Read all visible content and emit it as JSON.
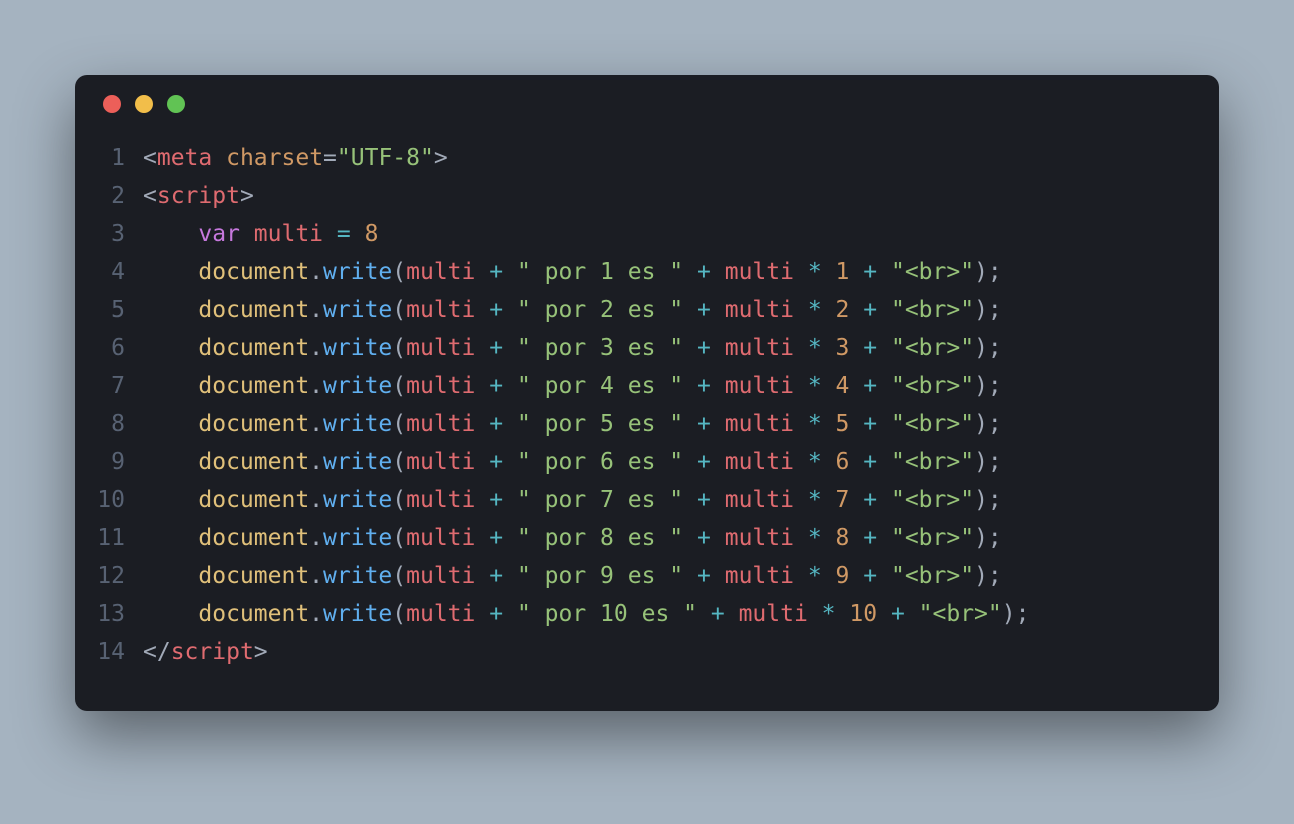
{
  "window": {
    "dots": [
      "red",
      "yellow",
      "green"
    ]
  },
  "lines": [
    {
      "num": "1",
      "tokens": [
        {
          "c": "punct",
          "t": "<"
        },
        {
          "c": "tag-red",
          "t": "meta"
        },
        {
          "c": "default",
          "t": " "
        },
        {
          "c": "attr",
          "t": "charset"
        },
        {
          "c": "punct",
          "t": "="
        },
        {
          "c": "string",
          "t": "\"UTF-8\""
        },
        {
          "c": "punct",
          "t": ">"
        }
      ]
    },
    {
      "num": "2",
      "tokens": [
        {
          "c": "punct",
          "t": "<"
        },
        {
          "c": "tag-red",
          "t": "script"
        },
        {
          "c": "punct",
          "t": ">"
        }
      ]
    },
    {
      "num": "3",
      "tokens": [
        {
          "c": "default",
          "t": "    "
        },
        {
          "c": "keyword",
          "t": "var"
        },
        {
          "c": "default",
          "t": " "
        },
        {
          "c": "varname",
          "t": "multi"
        },
        {
          "c": "default",
          "t": " "
        },
        {
          "c": "op",
          "t": "="
        },
        {
          "c": "default",
          "t": " "
        },
        {
          "c": "num",
          "t": "8"
        }
      ]
    },
    {
      "num": "4",
      "tokens": [
        {
          "c": "default",
          "t": "    "
        },
        {
          "c": "ident",
          "t": "document"
        },
        {
          "c": "punct",
          "t": "."
        },
        {
          "c": "method",
          "t": "write"
        },
        {
          "c": "punct",
          "t": "("
        },
        {
          "c": "varname",
          "t": "multi"
        },
        {
          "c": "default",
          "t": " "
        },
        {
          "c": "op",
          "t": "+"
        },
        {
          "c": "default",
          "t": " "
        },
        {
          "c": "string",
          "t": "\" por 1 es \""
        },
        {
          "c": "default",
          "t": " "
        },
        {
          "c": "op",
          "t": "+"
        },
        {
          "c": "default",
          "t": " "
        },
        {
          "c": "varname",
          "t": "multi"
        },
        {
          "c": "default",
          "t": " "
        },
        {
          "c": "op",
          "t": "*"
        },
        {
          "c": "default",
          "t": " "
        },
        {
          "c": "num",
          "t": "1"
        },
        {
          "c": "default",
          "t": " "
        },
        {
          "c": "op",
          "t": "+"
        },
        {
          "c": "default",
          "t": " "
        },
        {
          "c": "string",
          "t": "\"<br>\""
        },
        {
          "c": "punct",
          "t": ");"
        }
      ]
    },
    {
      "num": "5",
      "tokens": [
        {
          "c": "default",
          "t": "    "
        },
        {
          "c": "ident",
          "t": "document"
        },
        {
          "c": "punct",
          "t": "."
        },
        {
          "c": "method",
          "t": "write"
        },
        {
          "c": "punct",
          "t": "("
        },
        {
          "c": "varname",
          "t": "multi"
        },
        {
          "c": "default",
          "t": " "
        },
        {
          "c": "op",
          "t": "+"
        },
        {
          "c": "default",
          "t": " "
        },
        {
          "c": "string",
          "t": "\" por 2 es \""
        },
        {
          "c": "default",
          "t": " "
        },
        {
          "c": "op",
          "t": "+"
        },
        {
          "c": "default",
          "t": " "
        },
        {
          "c": "varname",
          "t": "multi"
        },
        {
          "c": "default",
          "t": " "
        },
        {
          "c": "op",
          "t": "*"
        },
        {
          "c": "default",
          "t": " "
        },
        {
          "c": "num",
          "t": "2"
        },
        {
          "c": "default",
          "t": " "
        },
        {
          "c": "op",
          "t": "+"
        },
        {
          "c": "default",
          "t": " "
        },
        {
          "c": "string",
          "t": "\"<br>\""
        },
        {
          "c": "punct",
          "t": ");"
        }
      ]
    },
    {
      "num": "6",
      "tokens": [
        {
          "c": "default",
          "t": "    "
        },
        {
          "c": "ident",
          "t": "document"
        },
        {
          "c": "punct",
          "t": "."
        },
        {
          "c": "method",
          "t": "write"
        },
        {
          "c": "punct",
          "t": "("
        },
        {
          "c": "varname",
          "t": "multi"
        },
        {
          "c": "default",
          "t": " "
        },
        {
          "c": "op",
          "t": "+"
        },
        {
          "c": "default",
          "t": " "
        },
        {
          "c": "string",
          "t": "\" por 3 es \""
        },
        {
          "c": "default",
          "t": " "
        },
        {
          "c": "op",
          "t": "+"
        },
        {
          "c": "default",
          "t": " "
        },
        {
          "c": "varname",
          "t": "multi"
        },
        {
          "c": "default",
          "t": " "
        },
        {
          "c": "op",
          "t": "*"
        },
        {
          "c": "default",
          "t": " "
        },
        {
          "c": "num",
          "t": "3"
        },
        {
          "c": "default",
          "t": " "
        },
        {
          "c": "op",
          "t": "+"
        },
        {
          "c": "default",
          "t": " "
        },
        {
          "c": "string",
          "t": "\"<br>\""
        },
        {
          "c": "punct",
          "t": ");"
        }
      ]
    },
    {
      "num": "7",
      "tokens": [
        {
          "c": "default",
          "t": "    "
        },
        {
          "c": "ident",
          "t": "document"
        },
        {
          "c": "punct",
          "t": "."
        },
        {
          "c": "method",
          "t": "write"
        },
        {
          "c": "punct",
          "t": "("
        },
        {
          "c": "varname",
          "t": "multi"
        },
        {
          "c": "default",
          "t": " "
        },
        {
          "c": "op",
          "t": "+"
        },
        {
          "c": "default",
          "t": " "
        },
        {
          "c": "string",
          "t": "\" por 4 es \""
        },
        {
          "c": "default",
          "t": " "
        },
        {
          "c": "op",
          "t": "+"
        },
        {
          "c": "default",
          "t": " "
        },
        {
          "c": "varname",
          "t": "multi"
        },
        {
          "c": "default",
          "t": " "
        },
        {
          "c": "op",
          "t": "*"
        },
        {
          "c": "default",
          "t": " "
        },
        {
          "c": "num",
          "t": "4"
        },
        {
          "c": "default",
          "t": " "
        },
        {
          "c": "op",
          "t": "+"
        },
        {
          "c": "default",
          "t": " "
        },
        {
          "c": "string",
          "t": "\"<br>\""
        },
        {
          "c": "punct",
          "t": ");"
        }
      ]
    },
    {
      "num": "8",
      "tokens": [
        {
          "c": "default",
          "t": "    "
        },
        {
          "c": "ident",
          "t": "document"
        },
        {
          "c": "punct",
          "t": "."
        },
        {
          "c": "method",
          "t": "write"
        },
        {
          "c": "punct",
          "t": "("
        },
        {
          "c": "varname",
          "t": "multi"
        },
        {
          "c": "default",
          "t": " "
        },
        {
          "c": "op",
          "t": "+"
        },
        {
          "c": "default",
          "t": " "
        },
        {
          "c": "string",
          "t": "\" por 5 es \""
        },
        {
          "c": "default",
          "t": " "
        },
        {
          "c": "op",
          "t": "+"
        },
        {
          "c": "default",
          "t": " "
        },
        {
          "c": "varname",
          "t": "multi"
        },
        {
          "c": "default",
          "t": " "
        },
        {
          "c": "op",
          "t": "*"
        },
        {
          "c": "default",
          "t": " "
        },
        {
          "c": "num",
          "t": "5"
        },
        {
          "c": "default",
          "t": " "
        },
        {
          "c": "op",
          "t": "+"
        },
        {
          "c": "default",
          "t": " "
        },
        {
          "c": "string",
          "t": "\"<br>\""
        },
        {
          "c": "punct",
          "t": ");"
        }
      ]
    },
    {
      "num": "9",
      "tokens": [
        {
          "c": "default",
          "t": "    "
        },
        {
          "c": "ident",
          "t": "document"
        },
        {
          "c": "punct",
          "t": "."
        },
        {
          "c": "method",
          "t": "write"
        },
        {
          "c": "punct",
          "t": "("
        },
        {
          "c": "varname",
          "t": "multi"
        },
        {
          "c": "default",
          "t": " "
        },
        {
          "c": "op",
          "t": "+"
        },
        {
          "c": "default",
          "t": " "
        },
        {
          "c": "string",
          "t": "\" por 6 es \""
        },
        {
          "c": "default",
          "t": " "
        },
        {
          "c": "op",
          "t": "+"
        },
        {
          "c": "default",
          "t": " "
        },
        {
          "c": "varname",
          "t": "multi"
        },
        {
          "c": "default",
          "t": " "
        },
        {
          "c": "op",
          "t": "*"
        },
        {
          "c": "default",
          "t": " "
        },
        {
          "c": "num",
          "t": "6"
        },
        {
          "c": "default",
          "t": " "
        },
        {
          "c": "op",
          "t": "+"
        },
        {
          "c": "default",
          "t": " "
        },
        {
          "c": "string",
          "t": "\"<br>\""
        },
        {
          "c": "punct",
          "t": ");"
        }
      ]
    },
    {
      "num": "10",
      "tokens": [
        {
          "c": "default",
          "t": "    "
        },
        {
          "c": "ident",
          "t": "document"
        },
        {
          "c": "punct",
          "t": "."
        },
        {
          "c": "method",
          "t": "write"
        },
        {
          "c": "punct",
          "t": "("
        },
        {
          "c": "varname",
          "t": "multi"
        },
        {
          "c": "default",
          "t": " "
        },
        {
          "c": "op",
          "t": "+"
        },
        {
          "c": "default",
          "t": " "
        },
        {
          "c": "string",
          "t": "\" por 7 es \""
        },
        {
          "c": "default",
          "t": " "
        },
        {
          "c": "op",
          "t": "+"
        },
        {
          "c": "default",
          "t": " "
        },
        {
          "c": "varname",
          "t": "multi"
        },
        {
          "c": "default",
          "t": " "
        },
        {
          "c": "op",
          "t": "*"
        },
        {
          "c": "default",
          "t": " "
        },
        {
          "c": "num",
          "t": "7"
        },
        {
          "c": "default",
          "t": " "
        },
        {
          "c": "op",
          "t": "+"
        },
        {
          "c": "default",
          "t": " "
        },
        {
          "c": "string",
          "t": "\"<br>\""
        },
        {
          "c": "punct",
          "t": ");"
        }
      ]
    },
    {
      "num": "11",
      "tokens": [
        {
          "c": "default",
          "t": "    "
        },
        {
          "c": "ident",
          "t": "document"
        },
        {
          "c": "punct",
          "t": "."
        },
        {
          "c": "method",
          "t": "write"
        },
        {
          "c": "punct",
          "t": "("
        },
        {
          "c": "varname",
          "t": "multi"
        },
        {
          "c": "default",
          "t": " "
        },
        {
          "c": "op",
          "t": "+"
        },
        {
          "c": "default",
          "t": " "
        },
        {
          "c": "string",
          "t": "\" por 8 es \""
        },
        {
          "c": "default",
          "t": " "
        },
        {
          "c": "op",
          "t": "+"
        },
        {
          "c": "default",
          "t": " "
        },
        {
          "c": "varname",
          "t": "multi"
        },
        {
          "c": "default",
          "t": " "
        },
        {
          "c": "op",
          "t": "*"
        },
        {
          "c": "default",
          "t": " "
        },
        {
          "c": "num",
          "t": "8"
        },
        {
          "c": "default",
          "t": " "
        },
        {
          "c": "op",
          "t": "+"
        },
        {
          "c": "default",
          "t": " "
        },
        {
          "c": "string",
          "t": "\"<br>\""
        },
        {
          "c": "punct",
          "t": ");"
        }
      ]
    },
    {
      "num": "12",
      "tokens": [
        {
          "c": "default",
          "t": "    "
        },
        {
          "c": "ident",
          "t": "document"
        },
        {
          "c": "punct",
          "t": "."
        },
        {
          "c": "method",
          "t": "write"
        },
        {
          "c": "punct",
          "t": "("
        },
        {
          "c": "varname",
          "t": "multi"
        },
        {
          "c": "default",
          "t": " "
        },
        {
          "c": "op",
          "t": "+"
        },
        {
          "c": "default",
          "t": " "
        },
        {
          "c": "string",
          "t": "\" por 9 es \""
        },
        {
          "c": "default",
          "t": " "
        },
        {
          "c": "op",
          "t": "+"
        },
        {
          "c": "default",
          "t": " "
        },
        {
          "c": "varname",
          "t": "multi"
        },
        {
          "c": "default",
          "t": " "
        },
        {
          "c": "op",
          "t": "*"
        },
        {
          "c": "default",
          "t": " "
        },
        {
          "c": "num",
          "t": "9"
        },
        {
          "c": "default",
          "t": " "
        },
        {
          "c": "op",
          "t": "+"
        },
        {
          "c": "default",
          "t": " "
        },
        {
          "c": "string",
          "t": "\"<br>\""
        },
        {
          "c": "punct",
          "t": ");"
        }
      ]
    },
    {
      "num": "13",
      "tokens": [
        {
          "c": "default",
          "t": "    "
        },
        {
          "c": "ident",
          "t": "document"
        },
        {
          "c": "punct",
          "t": "."
        },
        {
          "c": "method",
          "t": "write"
        },
        {
          "c": "punct",
          "t": "("
        },
        {
          "c": "varname",
          "t": "multi"
        },
        {
          "c": "default",
          "t": " "
        },
        {
          "c": "op",
          "t": "+"
        },
        {
          "c": "default",
          "t": " "
        },
        {
          "c": "string",
          "t": "\" por 10 es \""
        },
        {
          "c": "default",
          "t": " "
        },
        {
          "c": "op",
          "t": "+"
        },
        {
          "c": "default",
          "t": " "
        },
        {
          "c": "varname",
          "t": "multi"
        },
        {
          "c": "default",
          "t": " "
        },
        {
          "c": "op",
          "t": "*"
        },
        {
          "c": "default",
          "t": " "
        },
        {
          "c": "num",
          "t": "10"
        },
        {
          "c": "default",
          "t": " "
        },
        {
          "c": "op",
          "t": "+"
        },
        {
          "c": "default",
          "t": " "
        },
        {
          "c": "string",
          "t": "\"<br>\""
        },
        {
          "c": "punct",
          "t": ");"
        }
      ]
    },
    {
      "num": "14",
      "tokens": [
        {
          "c": "punct",
          "t": "</"
        },
        {
          "c": "tag-red",
          "t": "script"
        },
        {
          "c": "punct",
          "t": ">"
        }
      ]
    }
  ]
}
